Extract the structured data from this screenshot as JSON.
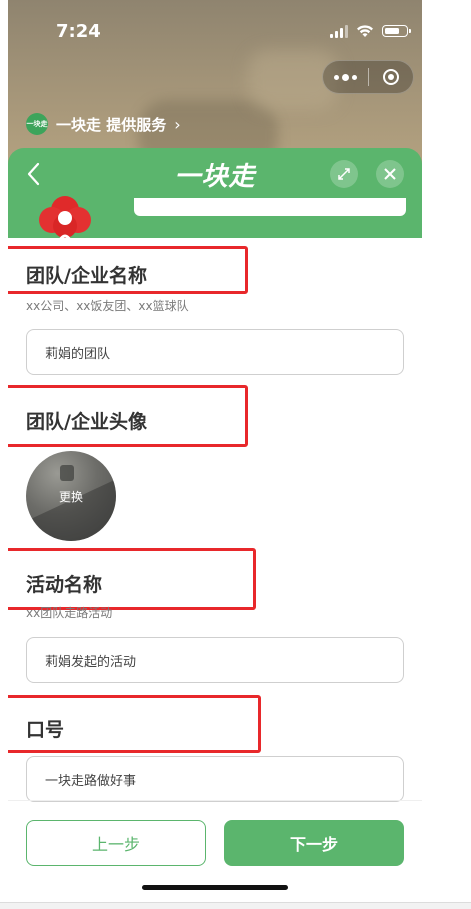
{
  "status_bar": {
    "time": "7:24"
  },
  "mini_program": {
    "service_logo_text": "一块走",
    "service_provider": "一块走 提供服务",
    "chevron": "›",
    "title": "一块走"
  },
  "form": {
    "team_name": {
      "label": "团队/企业名称",
      "hint": "xx公司、xx饭友团、xx篮球队",
      "value": "莉娟的团队"
    },
    "team_avatar": {
      "label": "团队/企业头像",
      "change_label": "更换"
    },
    "activity_name": {
      "label": "活动名称",
      "hint": "xx团队走路活动",
      "value": "莉娟发起的活动"
    },
    "slogan": {
      "label": "口号",
      "value": "一块走路做好事"
    }
  },
  "footer": {
    "prev_label": "上一步",
    "next_label": "下一步"
  },
  "colors": {
    "brand_green": "#5bb56d",
    "highlight_red": "#e8282b"
  }
}
